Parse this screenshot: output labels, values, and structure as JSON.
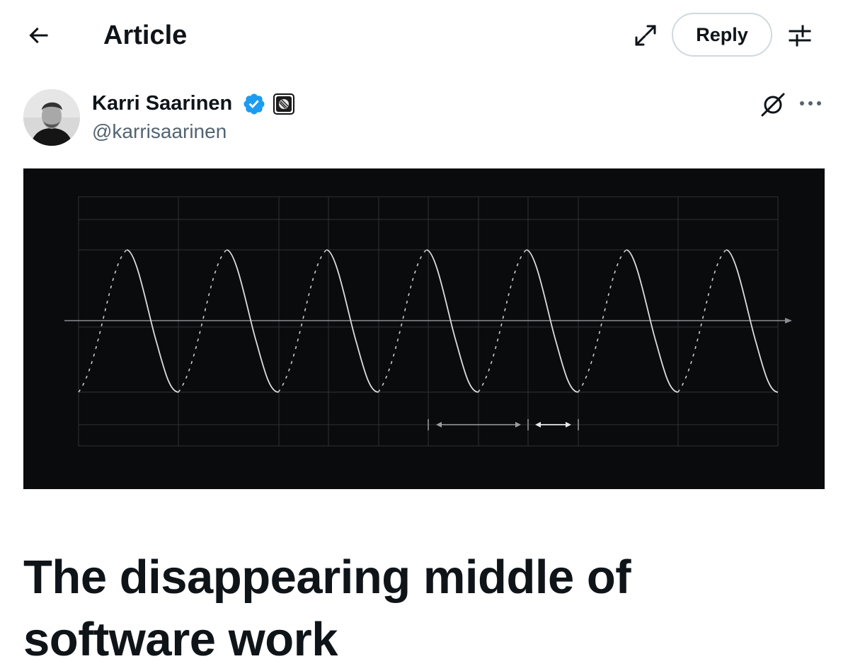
{
  "header": {
    "title": "Article",
    "reply_label": "Reply",
    "icons": {
      "back": "arrow-left-icon",
      "expand": "expand-icon",
      "settings": "sliders-icon"
    }
  },
  "author": {
    "name": "Karri Saarinen",
    "handle": "@karrisaarinen",
    "verified": true,
    "verified_color": "#1d9bf0",
    "icons": {
      "grok": "grok-icon",
      "more": "more-icon"
    }
  },
  "article": {
    "title": "The disappearing middle of software work",
    "cover_image": "waveform-diagram"
  },
  "colors": {
    "text": "#0f1419",
    "secondary_text": "#536471",
    "border": "#cfd9de",
    "cover_background": "#0a0b0d"
  }
}
